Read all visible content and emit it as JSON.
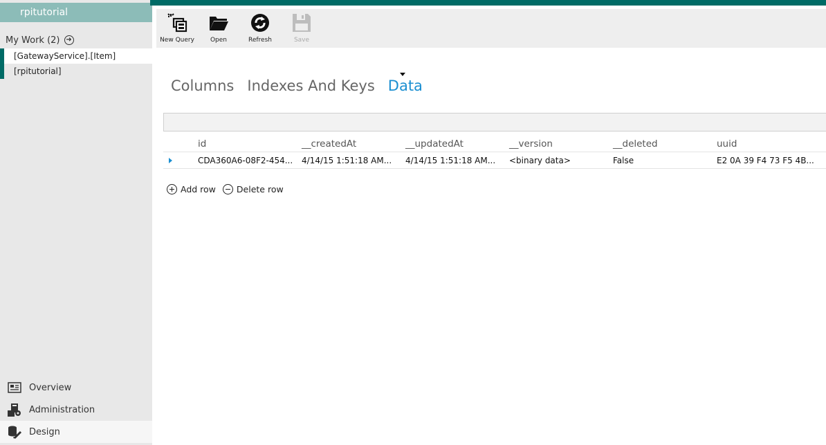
{
  "sidebar": {
    "header_title": "rpitutorial",
    "my_work_label": "My Work (2)",
    "work_items": [
      {
        "label": "[GatewayService].[Item]"
      },
      {
        "label": "[rpitutorial]"
      }
    ],
    "nav": [
      {
        "label": "Overview",
        "icon": "overview-icon"
      },
      {
        "label": "Administration",
        "icon": "administration-icon"
      },
      {
        "label": "Design",
        "icon": "design-icon"
      }
    ]
  },
  "toolbar": {
    "new_query": "New Query",
    "open": "Open",
    "refresh": "Refresh",
    "save": "Save"
  },
  "tabs": [
    {
      "label": "Columns"
    },
    {
      "label": "Indexes And Keys"
    },
    {
      "label": "Data",
      "active": true
    }
  ],
  "grid": {
    "columns": [
      "id",
      "__createdAt",
      "__updatedAt",
      "__version",
      "__deleted",
      "uuid"
    ],
    "rows": [
      [
        "CDA360A6-08F2-454...",
        "4/14/15 1:51:18 AM...",
        "4/14/15 1:51:18 AM...",
        "<binary data>",
        "False",
        "E2 0A 39 F4 73 F5 4B..."
      ]
    ]
  },
  "actions": {
    "add_row": "Add row",
    "delete_row": "Delete row"
  },
  "colors": {
    "accent": "#006b66",
    "header": "#8cbcb8",
    "active_tab": "#1b8fd1"
  }
}
